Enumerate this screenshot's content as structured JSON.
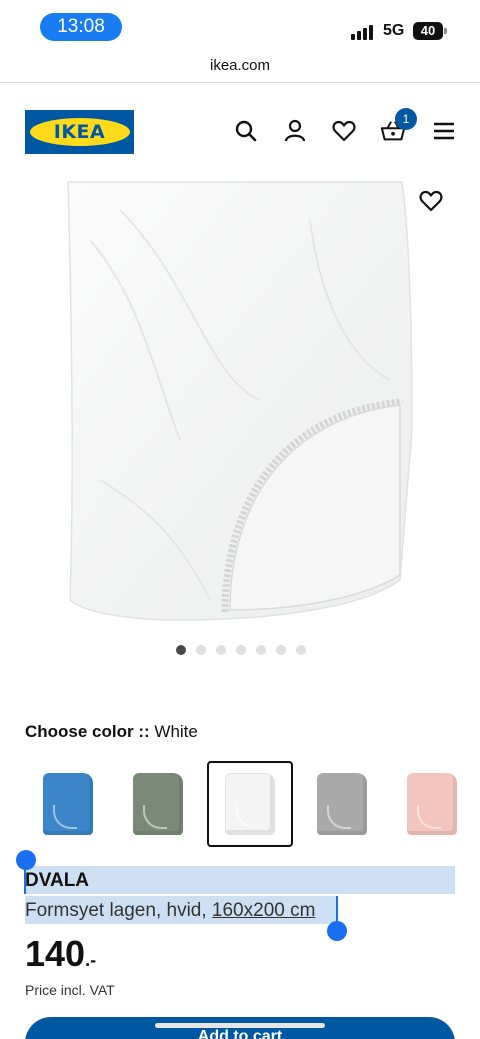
{
  "status": {
    "time": "13:08",
    "network": "5G",
    "battery": "40"
  },
  "browser": {
    "url": "ikea.com"
  },
  "header": {
    "logo_text": "IKEA",
    "icons": [
      "search-icon",
      "user-icon",
      "heart-icon",
      "basket-icon",
      "menu-icon"
    ],
    "cart_count": "1"
  },
  "gallery": {
    "image_count": 7,
    "active_index": 0
  },
  "color_picker": {
    "label": "Choose color ::",
    "selected": "White",
    "swatches": [
      {
        "name": "blue",
        "color": "#3a86c8"
      },
      {
        "name": "green",
        "color": "#7b8a78"
      },
      {
        "name": "white",
        "color": "#f4f4f4",
        "selected": true
      },
      {
        "name": "grey",
        "color": "#a9a9a9"
      },
      {
        "name": "pink",
        "color": "#f3c6bd"
      }
    ]
  },
  "product": {
    "name": "DVALA",
    "description": "Formsyet lagen, hvid,",
    "size": "160x200 cm",
    "price": "140",
    "price_suffix": ".-",
    "price_note": "Price incl. VAT",
    "add_button": "Add to cart"
  },
  "colors": {
    "ikea_blue": "#0058a3",
    "ikea_yellow": "#ffda1a",
    "selection": "#cde0f3",
    "handle": "#1a6ff0"
  }
}
